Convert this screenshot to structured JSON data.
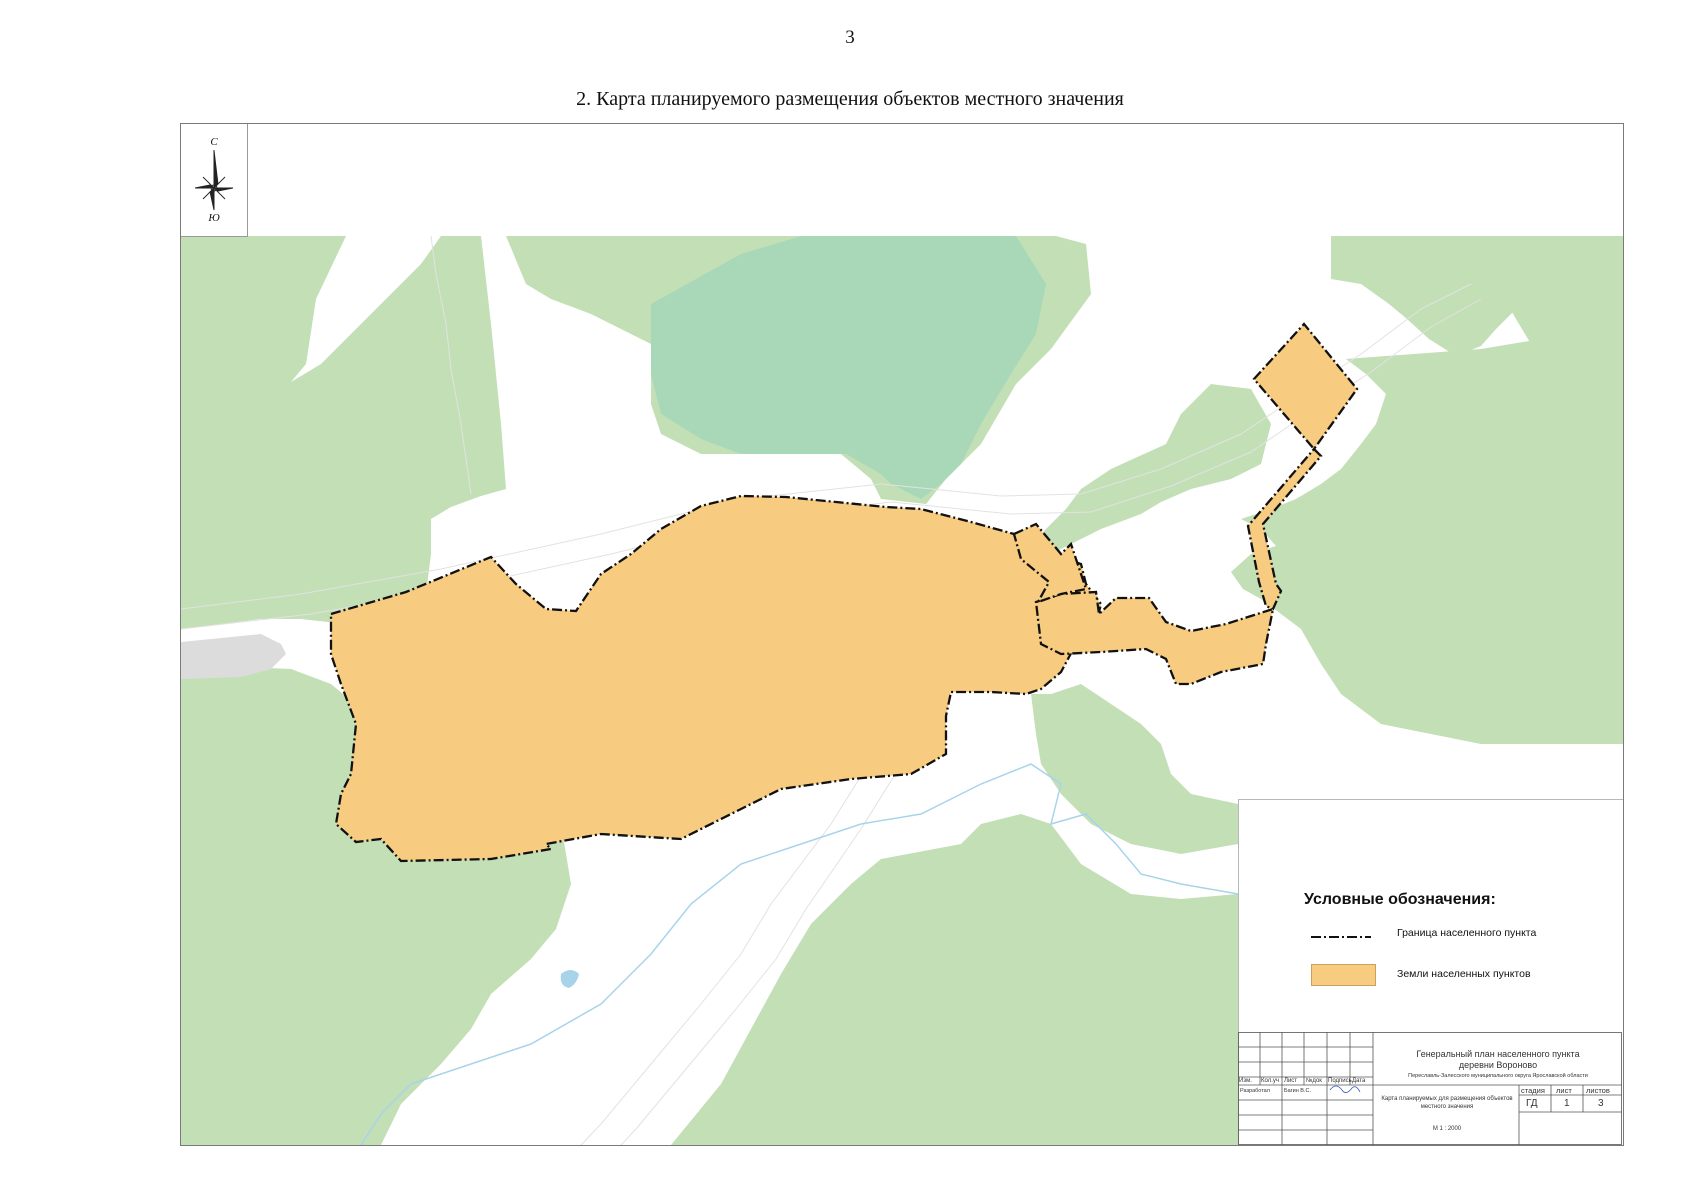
{
  "page_number": "3",
  "title": "2. Карта планируемого размещения объектов местного значения",
  "compass": {
    "north": "С",
    "south": "Ю"
  },
  "colors": {
    "forest": "#c3dfb6",
    "forest_dark": "#a9d8b8",
    "settlement": "#f8cc80",
    "water": "#a8d4ea",
    "boundary": "#111111"
  },
  "legend": {
    "title": "Условные обозначения:",
    "items": [
      {
        "label": "Граница населенного пункта",
        "symbol": "dash-dot-line"
      },
      {
        "label": "Земли населенных пунктов",
        "symbol": "fill-swatch"
      }
    ]
  },
  "title_block": {
    "project": "Генеральный план населенного пункта",
    "project_line2": "деревни Вороново",
    "region": "Переславль-Залесского муниципального округа Ярославской области",
    "headers": [
      "Изм.",
      "Кол.уч",
      "Лист",
      "№док",
      "Подпись",
      "Дата"
    ],
    "developed_label": "Разработал",
    "developer": "Багин В.С.",
    "sheet_name": "Карта планируемых для размещения объектов местного значения",
    "stage_label": "стадия",
    "sheet_label": "лист",
    "sheets_label": "листов",
    "stage": "ГД",
    "sheet": "1",
    "sheets": "3",
    "scale": "М 1 : 2000"
  }
}
